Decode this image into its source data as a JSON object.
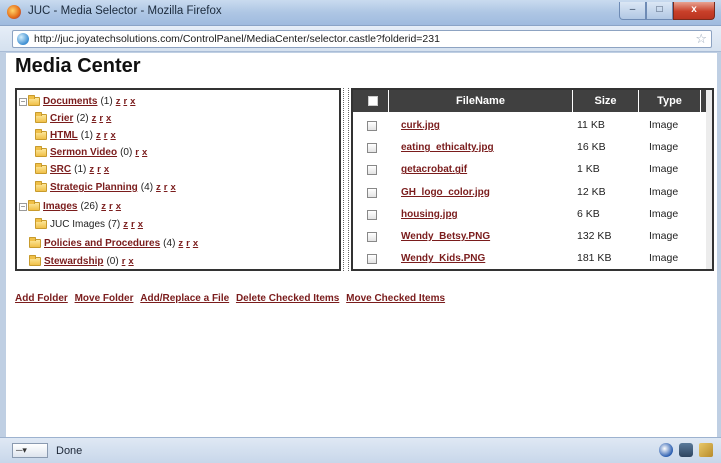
{
  "window": {
    "title": "JUC - Media Selector - Mozilla Firefox",
    "minimize_label": "–",
    "maximize_label": "□",
    "close_label": "x"
  },
  "address": {
    "url": "http://juc.joyatechsolutions.com/ControlPanel/MediaCenter/selector.castle?folderid=231"
  },
  "page": {
    "title": "Media Center"
  },
  "tree": {
    "toggle_expanded": "−",
    "items": [
      {
        "label": "Documents",
        "count": "(1)",
        "actions": [
          "z",
          "r",
          "x"
        ],
        "link": true,
        "toggle": true
      },
      {
        "label": "Crier",
        "count": "(2)",
        "actions": [
          "z",
          "r",
          "x"
        ],
        "link": true,
        "toggle": false
      },
      {
        "label": "HTML",
        "count": "(1)",
        "actions": [
          "z",
          "r",
          "x"
        ],
        "link": true,
        "toggle": false
      },
      {
        "label": "Sermon Video",
        "count": "(0)",
        "actions": [
          "r",
          "x"
        ],
        "link": true,
        "toggle": false
      },
      {
        "label": "SRC",
        "count": "(1)",
        "actions": [
          "z",
          "r",
          "x"
        ],
        "link": true,
        "toggle": false
      },
      {
        "label": "Strategic Planning",
        "count": "(4)",
        "actions": [
          "z",
          "r",
          "x"
        ],
        "link": true,
        "toggle": false
      },
      {
        "label": "Images",
        "count": "(26)",
        "actions": [
          "z",
          "r",
          "x"
        ],
        "link": true,
        "toggle": true
      },
      {
        "label": "JUC Images",
        "count": "(7)",
        "actions": [
          "z",
          "r",
          "x"
        ],
        "link": false,
        "toggle": false
      },
      {
        "label": "Policies and Procedures",
        "count": "(4)",
        "actions": [
          "z",
          "r",
          "x"
        ],
        "link": true,
        "toggle": false
      },
      {
        "label": "Stewardship",
        "count": "(0)",
        "actions": [
          "r",
          "x"
        ],
        "link": true,
        "toggle": false
      }
    ]
  },
  "grid": {
    "columns": [
      "FileName",
      "Size",
      "Type"
    ],
    "rows": [
      {
        "name": "curk.jpg",
        "size": "11 KB",
        "type": "Image"
      },
      {
        "name": "eating_ethicalty.jpg",
        "size": "16 KB",
        "type": "Image"
      },
      {
        "name": "getacrobat.gif",
        "size": "1 KB",
        "type": "Image"
      },
      {
        "name": "GH_logo_color.jpg",
        "size": "12 KB",
        "type": "Image"
      },
      {
        "name": "housing.jpg",
        "size": "6 KB",
        "type": "Image"
      },
      {
        "name": "Wendy_Betsy.PNG",
        "size": "132 KB",
        "type": "Image"
      },
      {
        "name": "Wendy_Kids.PNG",
        "size": "181 KB",
        "type": "Image"
      }
    ]
  },
  "actions": {
    "add_folder": "Add Folder",
    "move_folder": "Move Folder",
    "add_replace_file": "Add/Replace a File",
    "delete_checked": "Delete Checked Items",
    "move_checked": "Move Checked Items"
  },
  "status": {
    "text": "Done",
    "dropdown": "─▾"
  },
  "icons": {
    "title": "firefox-icon",
    "url": "globe-icon",
    "bookmark": "star-icon",
    "folder": "folder-icon"
  }
}
